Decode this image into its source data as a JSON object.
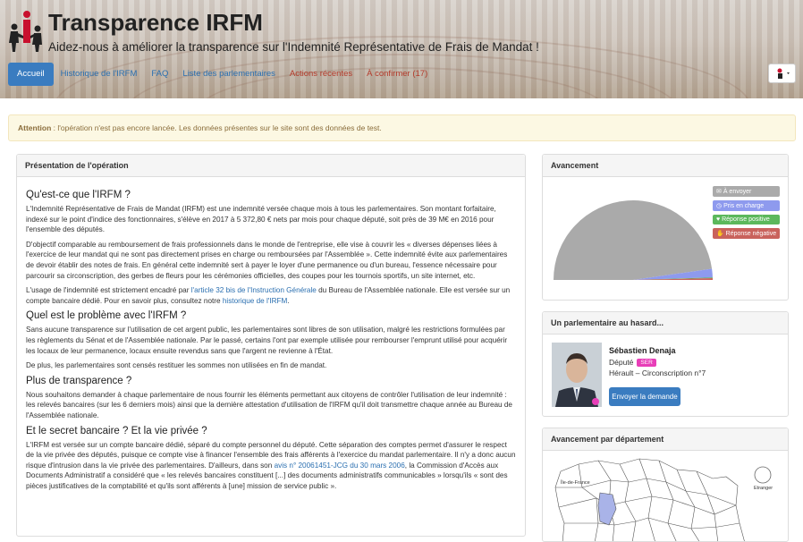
{
  "header": {
    "title": "Transparence IRFM",
    "subtitle": "Aidez-nous à améliorer la transparence sur l'Indemnité Représentative de Frais de Mandat !"
  },
  "nav": {
    "tabs": [
      {
        "label": "Accueil",
        "active": true
      },
      {
        "label": "Historique de l'IRFM"
      },
      {
        "label": "FAQ"
      },
      {
        "label": "Liste des parlementaires"
      },
      {
        "label": "Actions récentes"
      },
      {
        "label": "À confirmer (17)"
      }
    ]
  },
  "alert": {
    "strong": "Attention",
    "text": " : l'opération n'est pas encore lancée. Les données présentes sur le site sont des données de test."
  },
  "presentation": {
    "heading": "Présentation de l'opération",
    "s1_title": "Qu'est-ce que l'IRFM ?",
    "s1_p1": "L'Indemnité Représentative de Frais de Mandat (IRFM) est une indemnité versée chaque mois à tous les parlementaires. Son montant forfaitaire, indexé sur le point d'indice des fonctionnaires, s'élève en 2017 à 5 372,80 € nets par mois pour chaque député, soit près de 39 M€ en 2016 pour l'ensemble des députés.",
    "s1_p2": "D'objectif comparable au remboursement de frais professionnels dans le monde de l'entreprise, elle vise à couvrir les « diverses dépenses liées à l'exercice de leur mandat qui ne sont pas directement prises en charge ou remboursées par l'Assemblée ». Cette indemnité évite aux parlementaires de devoir établir des notes de frais. En général cette indemnité sert à payer le loyer d'une permanence ou d'un bureau, l'essence nécessaire pour parcourir sa circonscription, des gerbes de fleurs pour les cérémonies officielles, des coupes pour les tournois sportifs, un site internet, etc.",
    "s1_p3a": "L'usage de l'indemnité est strictement encadré par ",
    "s1_p3_link1": "l'article 32 bis de l'Instruction Générale",
    "s1_p3b": " du Bureau de l'Assemblée nationale. Elle est versée sur un compte bancaire dédié. Pour en savoir plus, consultez notre ",
    "s1_p3_link2": "historique de l'IRFM",
    "s1_p3c": ".",
    "s2_title": "Quel est le problème avec l'IRFM ?",
    "s2_p1": "Sans aucune transparence sur l'utilisation de cet argent public, les parlementaires sont libres de son utilisation, malgré les restrictions formulées par les règlements du Sénat et de l'Assemblée nationale. Par le passé, certains l'ont par exemple utilisée pour rembourser l'emprunt utilisé pour acquérir les locaux de leur permanence, locaux ensuite revendus sans que l'argent ne revienne à l'État.",
    "s2_p2": "De plus, les parlementaires sont censés restituer les sommes non utilisées en fin de mandat.",
    "s3_title": "Plus de transparence ?",
    "s3_p1": "Nous souhaitons demander à chaque parlementaire de nous fournir les éléments permettant aux citoyens de contrôler l'utilisation de leur indemnité : les relevés bancaires (sur les 6 derniers mois) ainsi que la dernière attestation d'utilisation de l'IRFM qu'il doit transmettre chaque année au Bureau de l'Assemblée nationale.",
    "s4_title": "Et le secret bancaire ? Et la vie privée ?",
    "s4_p1a": "L'IRFM est versée sur un compte bancaire dédié, séparé du compte personnel du député. Cette séparation des comptes permet d'assurer le respect de la vie privée des députés, puisque ce compte vise à financer l'ensemble des frais afférents à l'exercice du mandat parlementaire. Il n'y a donc aucun risque d'intrusion dans la vie privée des parlementaires. D'ailleurs, dans son ",
    "s4_p1_link": "avis n° 20061451-JCG du 30 mars 2006",
    "s4_p1b": ", la Commission d'Accès aux Documents Administratif a considéré que « les relevés bancaires constituent [...] des documents administratifs communicables » lorsqu'ils « sont des pièces justificatives de la comptabilité et qu'ils sont afférents à [une] mission de service public »."
  },
  "avancement": {
    "heading": "Avancement",
    "legend": [
      {
        "label": "À envoyer",
        "color": "#aaaaaa",
        "icon": "envelope-icon"
      },
      {
        "label": "Pris en charge",
        "color": "#8e9aee",
        "icon": "clock-icon"
      },
      {
        "label": "Réponse positive",
        "color": "#5cb85c",
        "icon": "heart-icon"
      },
      {
        "label": "Réponse négative",
        "color": "#c9625c",
        "icon": "thumbs-down-icon"
      }
    ],
    "chart_data": {
      "type": "pie",
      "categories": [
        "À envoyer",
        "Pris en charge",
        "Réponse positive",
        "Réponse négative"
      ],
      "values": [
        95.5,
        3.5,
        0.3,
        0.7
      ]
    }
  },
  "random": {
    "heading": "Un parlementaire au hasard...",
    "name": "Sébastien Denaja",
    "role": "Député",
    "party": "SER",
    "circ": "Hérault – Circonscription n°7",
    "button": "Envoyer la demande"
  },
  "departement": {
    "heading": "Avancement par département",
    "label_idf": "Île-de-France",
    "label_etranger": "Etranger"
  }
}
